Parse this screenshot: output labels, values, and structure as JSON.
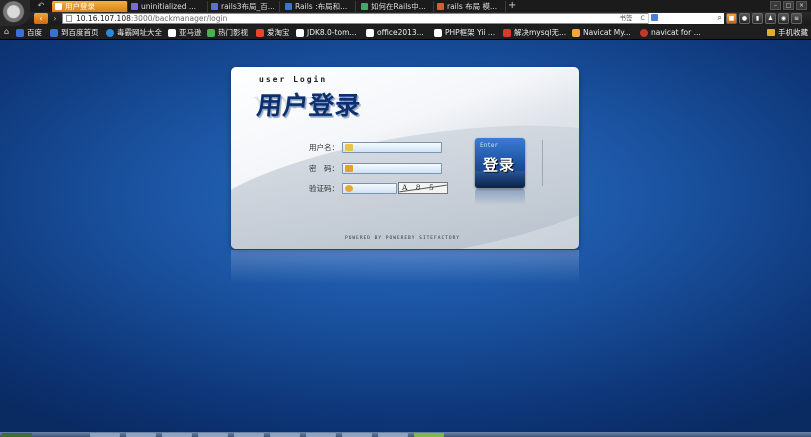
{
  "browser": {
    "tabs": [
      {
        "label": "用户登录",
        "active": true,
        "color": "#ffffff"
      },
      {
        "label": "uninitialized ...",
        "active": false,
        "color": "#7a6cd8"
      },
      {
        "label": "rails3布局_百...",
        "active": false,
        "color": "#5b6fd6"
      },
      {
        "label": "Rails :布局和...",
        "active": false,
        "color": "#3d73d9"
      },
      {
        "label": "如何在Rails中...",
        "active": false,
        "color": "#3fa86a"
      },
      {
        "label": "rails 布局 模...",
        "active": false,
        "color": "#d65a3b"
      }
    ],
    "new_tab_label": "+",
    "address": {
      "host": "10.16.107.108",
      "path": ":3000/backmanager/login",
      "right_text_1": "书签",
      "right_text_2": "C"
    },
    "bookmarks": [
      {
        "label": "百度",
        "color": "#3a6fd8"
      },
      {
        "label": "到百度首页",
        "color": "#3a6fd8"
      },
      {
        "label": "毒霸网址大全",
        "color": "#2a8ad8"
      },
      {
        "label": "亚马逊",
        "color": "#ffffff"
      },
      {
        "label": "热门影视",
        "color": "#4caf50"
      },
      {
        "label": "爱淘宝",
        "color": "#e8452b"
      },
      {
        "label": "JDK8.0-tom...",
        "color": "#ffffff"
      },
      {
        "label": "office2013...",
        "color": "#ffffff"
      },
      {
        "label": "PHP框架 Yii ...",
        "color": "#ffffff"
      },
      {
        "label": "解决mysql无...",
        "color": "#d93a2a"
      },
      {
        "label": "Navicat My...",
        "color": "#f3a63a"
      },
      {
        "label": "navicat for ...",
        "color": "#c0392b"
      }
    ],
    "mobile_bookmarks": "手机收藏"
  },
  "login": {
    "title_en": "user Login",
    "title_cn": "用户登录",
    "fields": [
      {
        "label": "用户名：",
        "value": "",
        "icon": "user-icon",
        "icon_color": "#e9c44a"
      },
      {
        "label": "密　码：",
        "value": "",
        "icon": "lock-icon",
        "icon_color": "#e6a02c"
      },
      {
        "label": "验证码：",
        "value": "",
        "icon": "key-icon",
        "icon_color": "#e7a736"
      }
    ],
    "captcha_text": "A 8 5 ч",
    "enter_en": "Enter",
    "enter_cn": "登录",
    "powered_by": "POWERED BY POWEREBY SITEFACTORY"
  }
}
